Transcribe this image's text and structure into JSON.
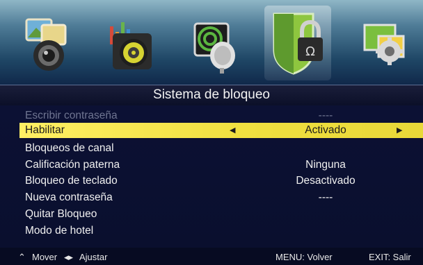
{
  "menu": {
    "title": "Sistema de bloqueo",
    "items": [
      {
        "label": "Escribir contraseña",
        "value": "----",
        "state": "disabled"
      },
      {
        "label": "Habilitar",
        "value": "Activado",
        "state": "selected"
      },
      {
        "label": "Bloqueos de canal",
        "value": ""
      },
      {
        "label": "Calificación paterna",
        "value": "Ninguna"
      },
      {
        "label": "Bloqueo de teclado",
        "value": "Desactivado"
      },
      {
        "label": "Nueva contraseña",
        "value": "----"
      },
      {
        "label": "Quitar Bloqueo",
        "value": ""
      },
      {
        "label": "Modo de hotel",
        "value": ""
      }
    ]
  },
  "icons": [
    {
      "name": "picture-camera-icon"
    },
    {
      "name": "sound-speaker-icon"
    },
    {
      "name": "channel-satellite-icon"
    },
    {
      "name": "lock-shield-icon",
      "selected": true
    },
    {
      "name": "settings-gear-icon"
    }
  ],
  "footer": {
    "move_symbol": "⌃",
    "move_label": "Mover",
    "adjust_symbol": "◂▸",
    "adjust_label": "Ajustar",
    "menu_label": "MENU: Volver",
    "exit_label": "EXIT: Salir"
  },
  "colors": {
    "highlight": "#f0e040",
    "background": "#0a1030",
    "disabled_text": "#6f7591"
  }
}
